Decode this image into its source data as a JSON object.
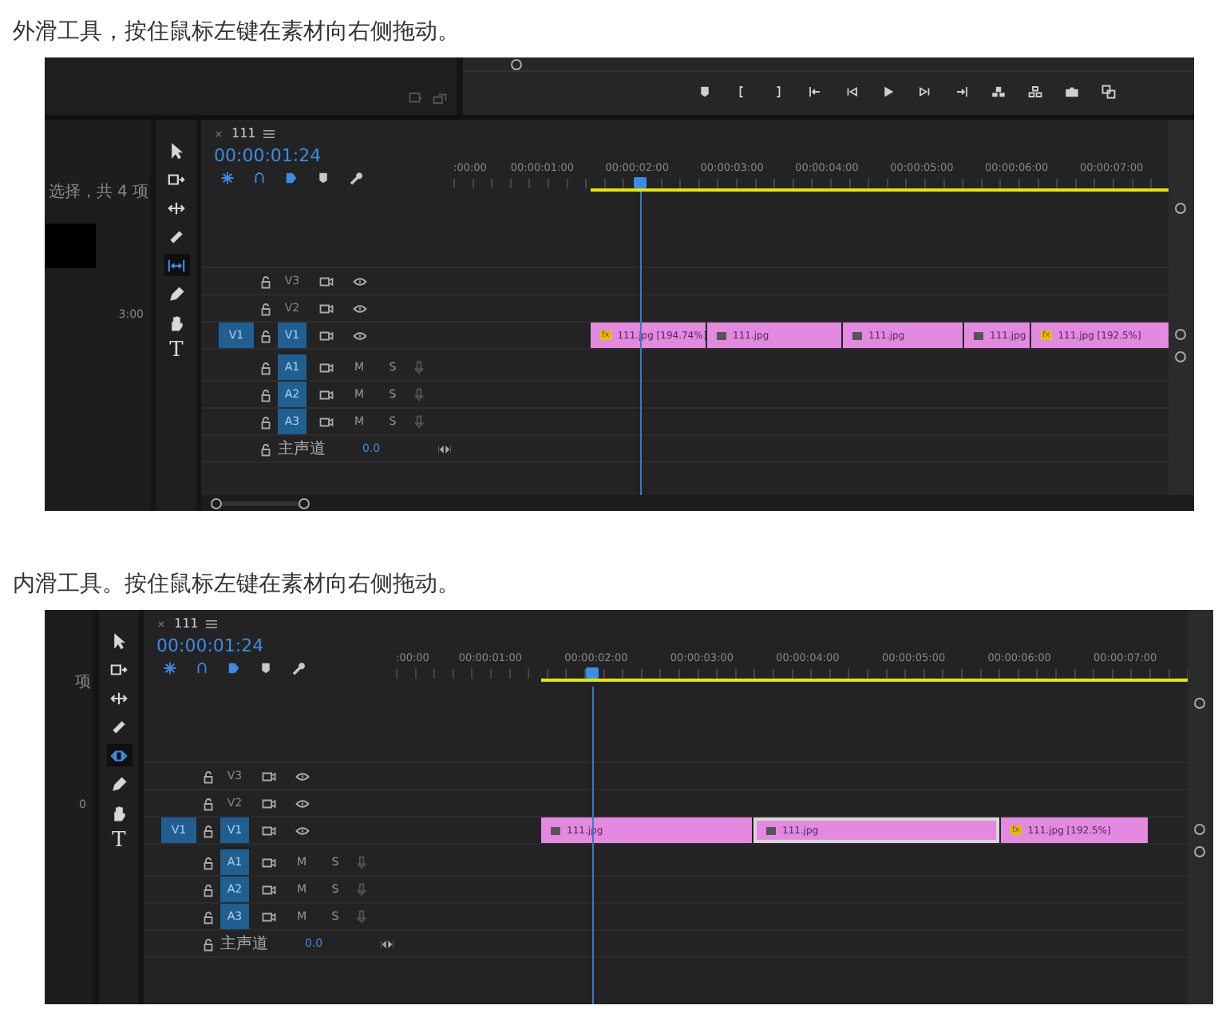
{
  "sections": [
    {
      "caption": "外滑工具，按住鼠标左键在素材向右侧拖动。",
      "screenshot": {
        "monitor_controls": true,
        "bottom_scrollbar": true,
        "project_panel": {
          "texts": [
            "选择，共 4 项",
            "3:00"
          ],
          "thumbnail": true
        },
        "tools": [
          {
            "kind": "selection",
            "selected": false
          },
          {
            "kind": "track-select",
            "selected": false
          },
          {
            "kind": "ripple",
            "selected": false
          },
          {
            "kind": "razor",
            "selected": false
          },
          {
            "kind": "slip",
            "selected": true
          },
          {
            "kind": "pen",
            "selected": false
          },
          {
            "kind": "hand",
            "selected": false
          },
          {
            "kind": "type",
            "label": "T",
            "selected": false
          }
        ],
        "timeline": {
          "tab": "111",
          "timecode": "00:00:01:24",
          "ruler_labels": [
            ":00:00",
            "00:00:01:00",
            "00:00:02:00",
            "00:00:03:00",
            "00:00:04:00",
            "00:00:05:00",
            "00:00:06:00",
            "00:00:07:00"
          ],
          "video_tracks": [
            {
              "name": "V3",
              "selected": false
            },
            {
              "name": "V2",
              "selected": false
            },
            {
              "name": "V1",
              "source": "V1",
              "selected": true
            }
          ],
          "audio_tracks": [
            {
              "name": "A1",
              "mute": "M",
              "solo": "S",
              "selected": true
            },
            {
              "name": "A2",
              "mute": "M",
              "solo": "S",
              "selected": true
            },
            {
              "name": "A3",
              "mute": "M",
              "solo": "S",
              "selected": true
            }
          ],
          "master": {
            "name": "主声道",
            "value": "0.0"
          },
          "clips": [
            {
              "label": "111.jpg [194.74%]",
              "badge": "fx",
              "selected": false
            },
            {
              "label": "111.jpg",
              "selected": false
            },
            {
              "label": "111.jpg",
              "selected": false
            },
            {
              "label": "111.jpg",
              "selected": false
            },
            {
              "label": "111.jpg [192.5%]",
              "badge": "fx",
              "selected": false
            }
          ]
        }
      }
    },
    {
      "caption": "内滑工具。按住鼠标左键在素材向右侧拖动。",
      "screenshot": {
        "monitor_controls": false,
        "bottom_scrollbar": false,
        "project_panel": {
          "texts": [
            "项",
            "0"
          ],
          "thumbnail": false
        },
        "tools": [
          {
            "kind": "selection",
            "selected": false
          },
          {
            "kind": "track-select",
            "selected": false
          },
          {
            "kind": "ripple",
            "selected": false
          },
          {
            "kind": "razor",
            "selected": false
          },
          {
            "kind": "slide",
            "selected": true
          },
          {
            "kind": "pen",
            "selected": false
          },
          {
            "kind": "hand",
            "selected": false
          },
          {
            "kind": "type",
            "label": "T",
            "selected": false
          }
        ],
        "timeline": {
          "tab": "111",
          "timecode": "00:00:01:24",
          "ruler_labels": [
            ":00:00",
            "00:00:01:00",
            "00:00:02:00",
            "00:00:03:00",
            "00:00:04:00",
            "00:00:05:00",
            "00:00:06:00",
            "00:00:07:00"
          ],
          "video_tracks": [
            {
              "name": "V3",
              "selected": false
            },
            {
              "name": "V2",
              "selected": false
            },
            {
              "name": "V1",
              "source": "V1",
              "selected": true
            }
          ],
          "audio_tracks": [
            {
              "name": "A1",
              "mute": "M",
              "solo": "S",
              "selected": true
            },
            {
              "name": "A2",
              "mute": "M",
              "solo": "S",
              "selected": true
            },
            {
              "name": "A3",
              "mute": "M",
              "solo": "S",
              "selected": true
            }
          ],
          "master": {
            "name": "主声道",
            "value": "0.0"
          },
          "clips": [
            {
              "label": "111.jpg",
              "selected": false
            },
            {
              "label": "111.jpg",
              "selected": true
            },
            {
              "label": "111.jpg [192.5%]",
              "badge": "fx",
              "selected": false
            }
          ]
        }
      }
    }
  ]
}
